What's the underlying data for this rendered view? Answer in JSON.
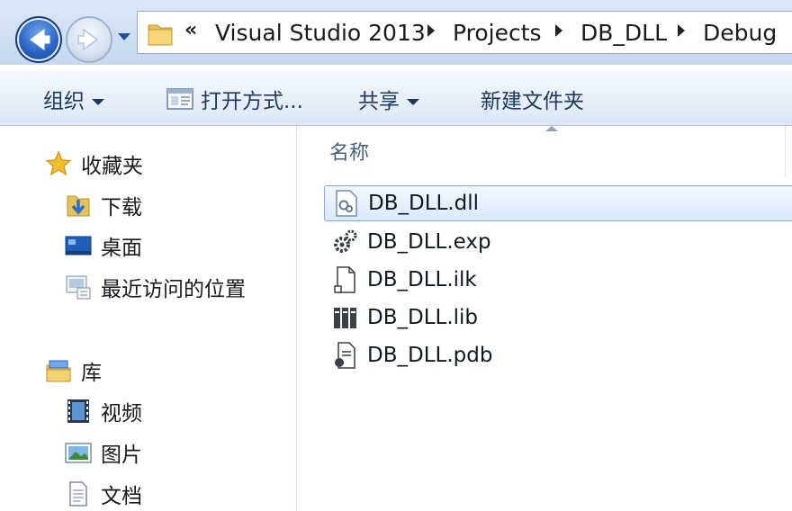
{
  "address_bar": {
    "overflow_glyph": "«",
    "crumbs": [
      "Visual Studio 2013",
      "Projects",
      "DB_DLL",
      "Debug"
    ]
  },
  "toolbar": {
    "organize": "组织",
    "open_with": "打开方式...",
    "share": "共享",
    "new_folder": "新建文件夹"
  },
  "nav_pane": {
    "favorites": {
      "label": "收藏夹",
      "items": [
        {
          "label": "下载",
          "icon": "downloads-folder-icon"
        },
        {
          "label": "桌面",
          "icon": "desktop-icon"
        },
        {
          "label": "最近访问的位置",
          "icon": "recent-places-icon"
        }
      ]
    },
    "libraries": {
      "label": "库",
      "items": [
        {
          "label": "视频",
          "icon": "video-library-icon"
        },
        {
          "label": "图片",
          "icon": "pictures-library-icon"
        },
        {
          "label": "文档",
          "icon": "documents-library-icon"
        }
      ]
    }
  },
  "file_list": {
    "column_name": "名称",
    "files": [
      {
        "name": "DB_DLL.dll",
        "icon": "dll-file-icon",
        "selected": true
      },
      {
        "name": "DB_DLL.exp",
        "icon": "exp-file-icon",
        "selected": false
      },
      {
        "name": "DB_DLL.ilk",
        "icon": "ilk-file-icon",
        "selected": false
      },
      {
        "name": "DB_DLL.lib",
        "icon": "lib-file-icon",
        "selected": false
      },
      {
        "name": "DB_DLL.pdb",
        "icon": "pdb-file-icon",
        "selected": false
      }
    ]
  },
  "colors": {
    "accent": "#2a64c4",
    "selection_border": "#84acdd",
    "toolbar_text": "#1e395b"
  }
}
